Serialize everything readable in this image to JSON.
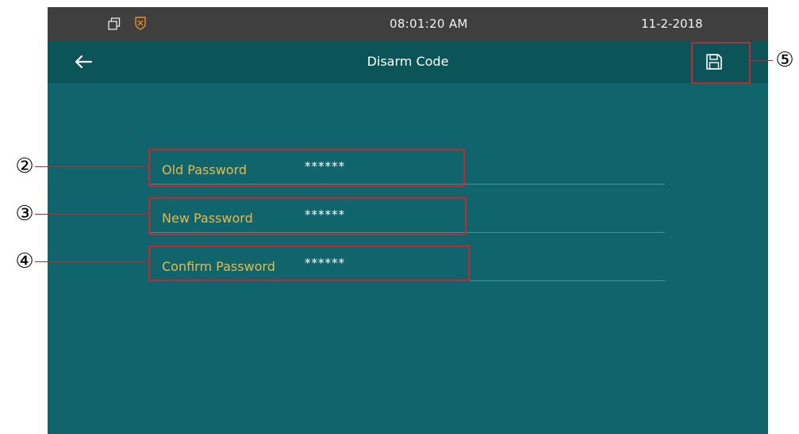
{
  "status_bar": {
    "time": "08:01:20   AM",
    "date": "11-2-2018",
    "icons": [
      "window-icon",
      "shield-icon"
    ]
  },
  "title_bar": {
    "title": "Disarm Code",
    "back_icon": "back-arrow-icon",
    "save_icon": "save-icon"
  },
  "form": {
    "fields": [
      {
        "label": "Old Password",
        "value": "******"
      },
      {
        "label": "New Password",
        "value": "******"
      },
      {
        "label": "Confirm Password",
        "value": "******"
      }
    ]
  },
  "callouts": [
    "②",
    "③",
    "④",
    "⑤"
  ],
  "colors": {
    "screen_bg": "#0f656b",
    "title_bg": "#0b5559",
    "status_bg": "#3f3f3f",
    "label": "#e8b94a",
    "highlight": "#c9252c"
  }
}
